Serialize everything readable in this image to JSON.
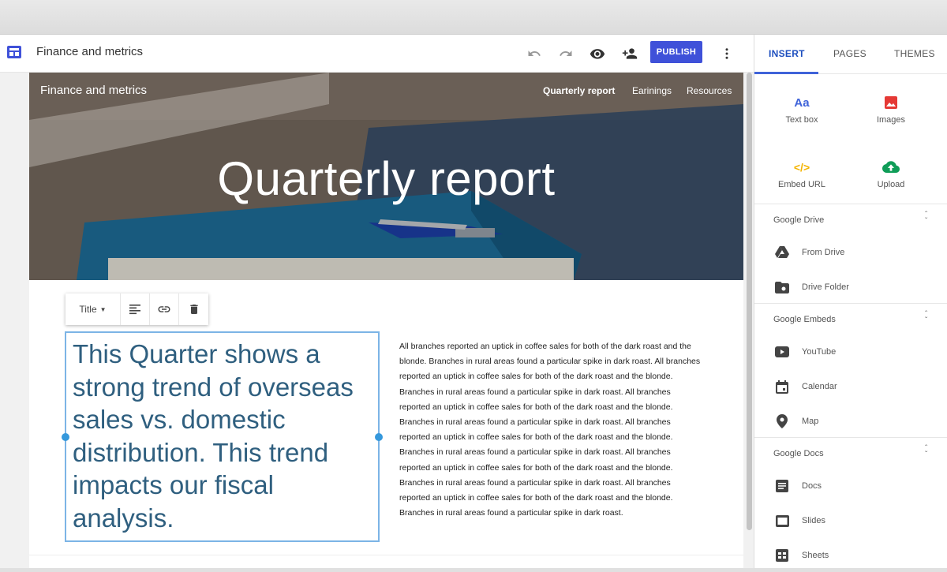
{
  "header": {
    "doc_title": "Finance and metrics",
    "publish_label": "PUBLISH"
  },
  "hero": {
    "site_title": "Finance and metrics",
    "nav": [
      "Quarterly report",
      "Earinings",
      "Resources"
    ],
    "page_title": "Quarterly report"
  },
  "text_toolbar": {
    "style_label": "Title"
  },
  "content": {
    "title_text": "This Quarter shows a strong trend of overseas sales vs. domestic distribution.  This trend impacts our fiscal analysis.",
    "body_text": "All branches reported an uptick in coffee sales for both of the dark roast and the blonde.  Branches in rural areas found a particular spike in dark roast.  All branches reported an uptick in coffee sales for both of the dark roast and the blonde.  Branches in rural areas found a particular spike in dark roast.  All branches reported an uptick in coffee sales for both of the dark roast and the blonde.  Branches in rural areas found a particular spike in dark roast.  All branches reported an uptick in coffee sales for both of the dark roast and the blonde.  Branches in rural areas found a particular spike in dark roast.  All branches reported an uptick in coffee sales for both of the dark roast and the blonde.  Branches in rural areas found a particular spike in dark roast.  All branches reported an uptick in coffee sales for both of the dark roast and the blonde.  Branches in rural areas found a particular spike in dark roast."
  },
  "panel": {
    "tabs": [
      "INSERT",
      "PAGES",
      "THEMES"
    ],
    "tiles": [
      {
        "label": "Text box",
        "icon": "text-box-icon"
      },
      {
        "label": "Images",
        "icon": "image-icon"
      },
      {
        "label": "Embed URL",
        "icon": "embed-code-icon"
      },
      {
        "label": "Upload",
        "icon": "cloud-upload-icon"
      }
    ],
    "groups": [
      {
        "title": "Google Drive",
        "items": [
          {
            "label": "From Drive",
            "icon": "drive-icon"
          },
          {
            "label": "Drive Folder",
            "icon": "folder-icon"
          }
        ]
      },
      {
        "title": "Google Embeds",
        "items": [
          {
            "label": "YouTube",
            "icon": "youtube-icon"
          },
          {
            "label": "Calendar",
            "icon": "calendar-icon"
          },
          {
            "label": "Map",
            "icon": "map-pin-icon"
          }
        ]
      },
      {
        "title": "Google Docs",
        "items": [
          {
            "label": "Docs",
            "icon": "docs-icon"
          },
          {
            "label": "Slides",
            "icon": "slides-icon"
          },
          {
            "label": "Sheets",
            "icon": "sheets-icon"
          }
        ]
      }
    ]
  },
  "colors": {
    "accent": "#3f51d9",
    "selection": "#7cb4e6",
    "title_text": "#2f5f7f"
  }
}
